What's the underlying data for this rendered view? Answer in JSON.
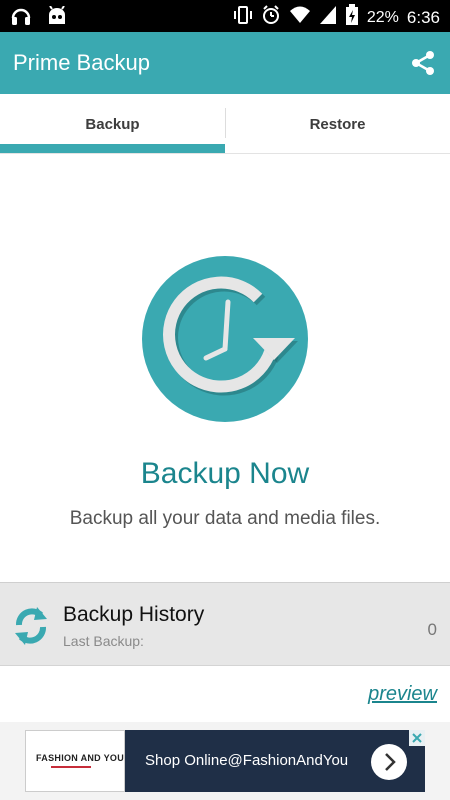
{
  "status_bar": {
    "battery_percent": "22%",
    "time": "6:36"
  },
  "app_bar": {
    "title": "Prime Backup"
  },
  "tabs": [
    {
      "label": "Backup",
      "active": true
    },
    {
      "label": "Restore",
      "active": false
    }
  ],
  "main": {
    "heading": "Backup Now",
    "description": "Backup all your data and media files."
  },
  "history": {
    "title": "Backup History",
    "subtitle": "Last Backup:",
    "count": "0"
  },
  "preview_link": "preview",
  "ad": {
    "logo_text": "FASHION AND YOU",
    "text": "Shop Online@FashionAndYou"
  },
  "colors": {
    "primary": "#3aa9b1",
    "accent_text": "#1b858d",
    "hero_circle": "#3aa9b1"
  }
}
